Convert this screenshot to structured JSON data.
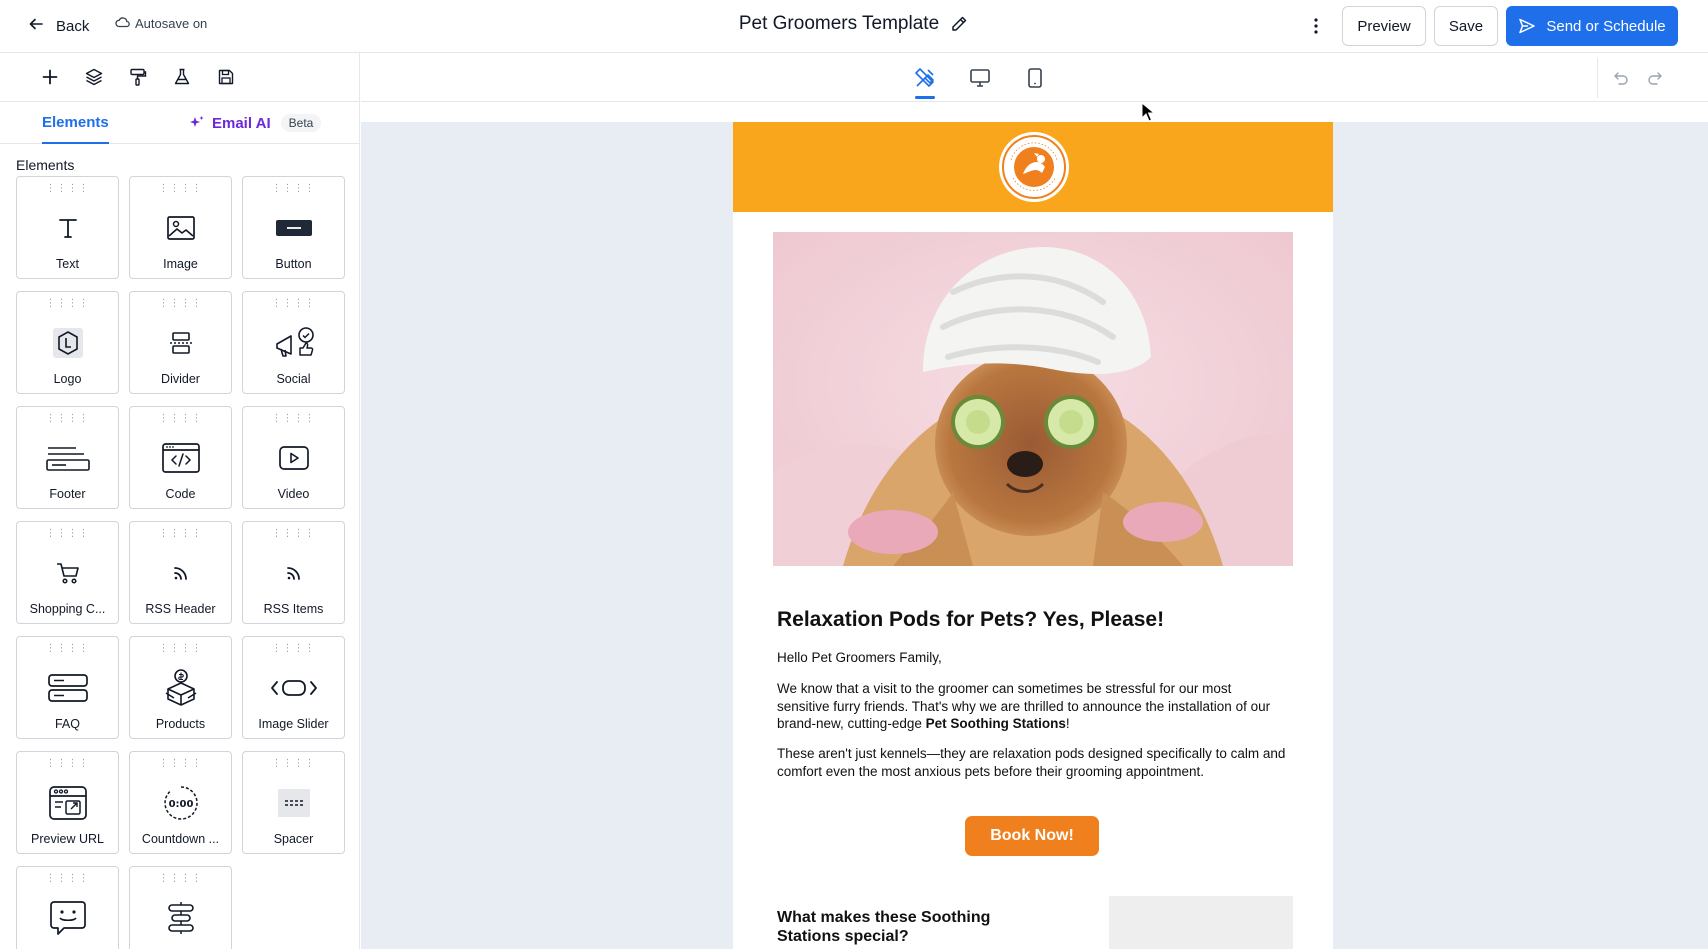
{
  "header": {
    "back_label": "Back",
    "autosave_label": "Autosave on",
    "title": "Pet Groomers Template",
    "preview_label": "Preview",
    "save_label": "Save",
    "send_label": "Send or Schedule"
  },
  "left_panel": {
    "tabs": {
      "elements": "Elements",
      "email_ai": "Email AI",
      "beta": "Beta"
    },
    "section_label": "Elements",
    "elements": [
      {
        "label": "Text",
        "icon": "text-icon"
      },
      {
        "label": "Image",
        "icon": "image-icon"
      },
      {
        "label": "Button",
        "icon": "button-icon"
      },
      {
        "label": "Logo",
        "icon": "logo-icon"
      },
      {
        "label": "Divider",
        "icon": "divider-icon"
      },
      {
        "label": "Social",
        "icon": "social-icon"
      },
      {
        "label": "Footer",
        "icon": "footer-icon"
      },
      {
        "label": "Code",
        "icon": "code-icon"
      },
      {
        "label": "Video",
        "icon": "video-icon"
      },
      {
        "label": "Shopping C...",
        "icon": "shopping-cart-icon"
      },
      {
        "label": "RSS Header",
        "icon": "rss-icon"
      },
      {
        "label": "RSS Items",
        "icon": "rss-icon"
      },
      {
        "label": "FAQ",
        "icon": "faq-icon"
      },
      {
        "label": "Products",
        "icon": "products-icon"
      },
      {
        "label": "Image Slider",
        "icon": "image-slider-icon"
      },
      {
        "label": "Preview URL",
        "icon": "preview-url-icon"
      },
      {
        "label": "Countdown ...",
        "icon": "countdown-icon"
      },
      {
        "label": "Spacer",
        "icon": "spacer-icon"
      },
      {
        "label": "",
        "icon": "chat-widget-icon"
      },
      {
        "label": "",
        "icon": "stack-icon"
      }
    ]
  },
  "email": {
    "logo_ring_text": "DOG TRAINING LOGO · YOUR SLOGAN HERE",
    "headline": "Relaxation Pods for Pets? Yes, Please!",
    "greeting": "Hello Pet Groomers Family,",
    "para1_before": "We know that a visit to the groomer can sometimes be stressful for our most sensitive furry friends. That's why we are thrilled to announce the installation of our brand-new, cutting-edge ",
    "para1_bold": "Pet Soothing Stations",
    "para1_after": "!",
    "para2": "These aren't just kennels—they are relaxation pods designed specifically to calm and comfort even the most anxious pets before their grooming appointment.",
    "cta_label": "Book Now!",
    "sub_heading": "What makes these Soothing Stations special?"
  },
  "colors": {
    "primary": "#1f6feb",
    "ai_purple": "#6d28d9",
    "header_orange": "#f9a61d",
    "cta_orange": "#f0801e",
    "canvas_bg": "#e8edf3"
  }
}
